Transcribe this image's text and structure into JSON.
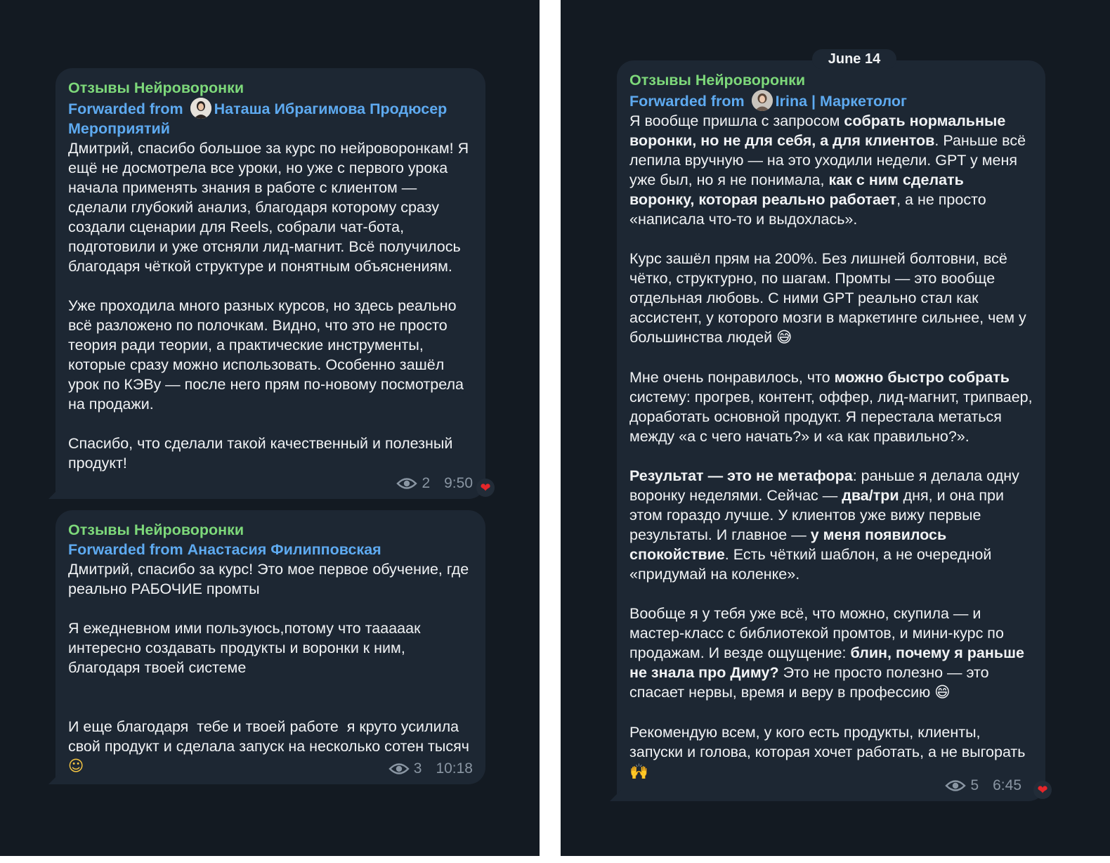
{
  "colors": {
    "background": "#131a22",
    "bubble": "#1d2733",
    "channel_name": "#7dd87a",
    "forwarded": "#5eaaf0",
    "meta": "#8a96a3",
    "heart": "#e5262a"
  },
  "left_panel": {
    "messages": [
      {
        "channel": "Отзывы Нейроворонки",
        "forwarded_prefix": "Forwarded from",
        "forwarded_name": "Наташа Ибрагимова Продюсер Мероприятий",
        "paragraphs": [
          "Дмитрий, спасибо большое за курс по нейроворонкам! Я ещё не досмотрела все уроки, но уже с первого урока начала применять знания в работе с клиентом — сделали глубокий анализ, благодаря которому сразу создали сценарии для Reels, собрали чат-бота, подготовили и уже отсняли лид-магнит. Всё получилось благодаря чёткой структуре и понятным объяснениям.",
          "Уже проходила много разных курсов, но здесь реально всё разложено по полочкам. Видно, что это не просто теория ради теории, а практические инструменты, которые сразу можно использовать. Особенно зашёл урок по КЭВу — после него прям по-новому посмотрела на продажи.",
          "Спасибо, что сделали такой качественный и полезный продукт!"
        ],
        "views": "2",
        "time": "9:50",
        "reaction_icon": "heart-icon"
      },
      {
        "channel": "Отзывы Нейроворонки",
        "forwarded_prefix": "Forwarded from",
        "forwarded_name": "Анастасия Филипповская",
        "paragraphs": [
          "Дмитрий, спасибо за курс! Это мое первое обучение, где реально РАБОЧИЕ промты",
          "Я ежедневном ими пользуюсь,потому что таааaак интересно создавать продукты и воронки к ним, благодаря твоей системе",
          "И еще благодаря  тебе и твоей работе  я круто усилила свой продукт и сделала запуск на несколько сотен тысяч"
        ],
        "emoji_end": "☺",
        "views": "3",
        "time": "10:18"
      }
    ]
  },
  "right_panel": {
    "date_label": "June 14",
    "message": {
      "channel": "Отзывы Нейроворонки",
      "forwarded_prefix": "Forwarded from",
      "forwarded_name": "Irina | Маркетолог",
      "p1": {
        "t1": "Я вообще пришла с запросом ",
        "b1": "собрать нормальные воронки, но не для себя, а для клиентов",
        "t2": ". Раньше всё лепила вручную — на это уходили недели. GPT у меня уже был, но я не понимала, ",
        "b2": "как с ним сделать воронку, которая реально работает",
        "t3": ", а не просто «написала что-то и выдохлась»."
      },
      "p2": {
        "t1": "Курс зашёл прям на 200%. Без лишней болтовни, всё чётко, структурно, по шагам. Промты — это вообще отдельная любовь. С ними GPT реально стал как ассистент, у которого мозги в маркетинге сильнее, чем у большинства людей",
        "emoji": "😅"
      },
      "p3": {
        "t1": "Мне очень понравилось, что ",
        "b1": "можно быстро собрать",
        "t2": " систему: прогрев, контент, оффер, лид-магнит, трипваер, доработать основной продукт. Я перестала метаться между «а с чего начать?» и «а как правильно?»."
      },
      "p4": {
        "b1": "Результат — это не метафора",
        "t1": ": раньше я делала одну воронку неделями. Сейчас — ",
        "b2": "два/три",
        "t2": " дня, и она при этом гораздо лучше. У клиентов уже вижу первые результаты. И главное — ",
        "b3": "у меня появилось спокойствие",
        "t3": ". Есть чёткий шаблон, а не очередной «придумай на коленке»."
      },
      "p5": {
        "t1": "Вообще я у тебя уже всё, что можно, скупила — и мастер-класс с библиотекой промтов, и мини-курс по продажам. И везде ощущение: ",
        "b1": "блин, почему я раньше не знала про Диму?",
        "t2": " Это не просто полезно — это спасает нервы, время и веру в профессию",
        "emoji": "😄"
      },
      "p6": {
        "t1": "Рекомендую всем, у кого есть продукты, клиенты, запуски и голова, которая хочет работать, а не выгорать",
        "emoji": "🙌"
      },
      "views": "5",
      "time": "6:45",
      "reaction_icon": "heart-icon"
    }
  }
}
